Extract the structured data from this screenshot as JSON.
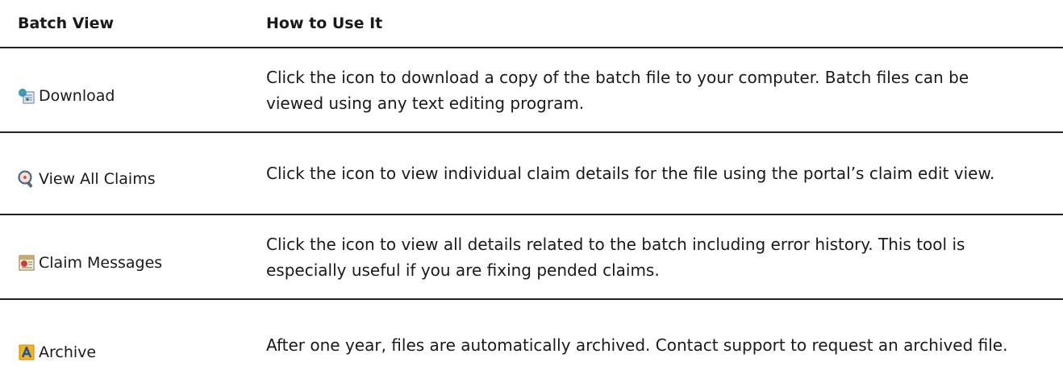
{
  "header": {
    "col1": "Batch View",
    "col2": "How to Use It"
  },
  "rows": [
    {
      "label": "Download",
      "icon": "download-icon",
      "description": "Click the icon to download a copy of the batch file to your computer. Batch files can be viewed using any text editing program."
    },
    {
      "label": "View All Claims",
      "icon": "magnifier-icon",
      "description": "Click the icon to view individual claim details for the file using the portal’s claim edit view."
    },
    {
      "label": "Claim Messages",
      "icon": "messages-icon",
      "description": "Click the icon to view all details related to the batch including error history. This tool is especially useful if you are fixing pended claims."
    },
    {
      "label": "Archive",
      "icon": "archive-icon",
      "description": "After one year, files are automatically archived. Contact support to request an archived file."
    }
  ],
  "colors": {
    "rule": "#222222",
    "text": "#1a1a1a"
  }
}
